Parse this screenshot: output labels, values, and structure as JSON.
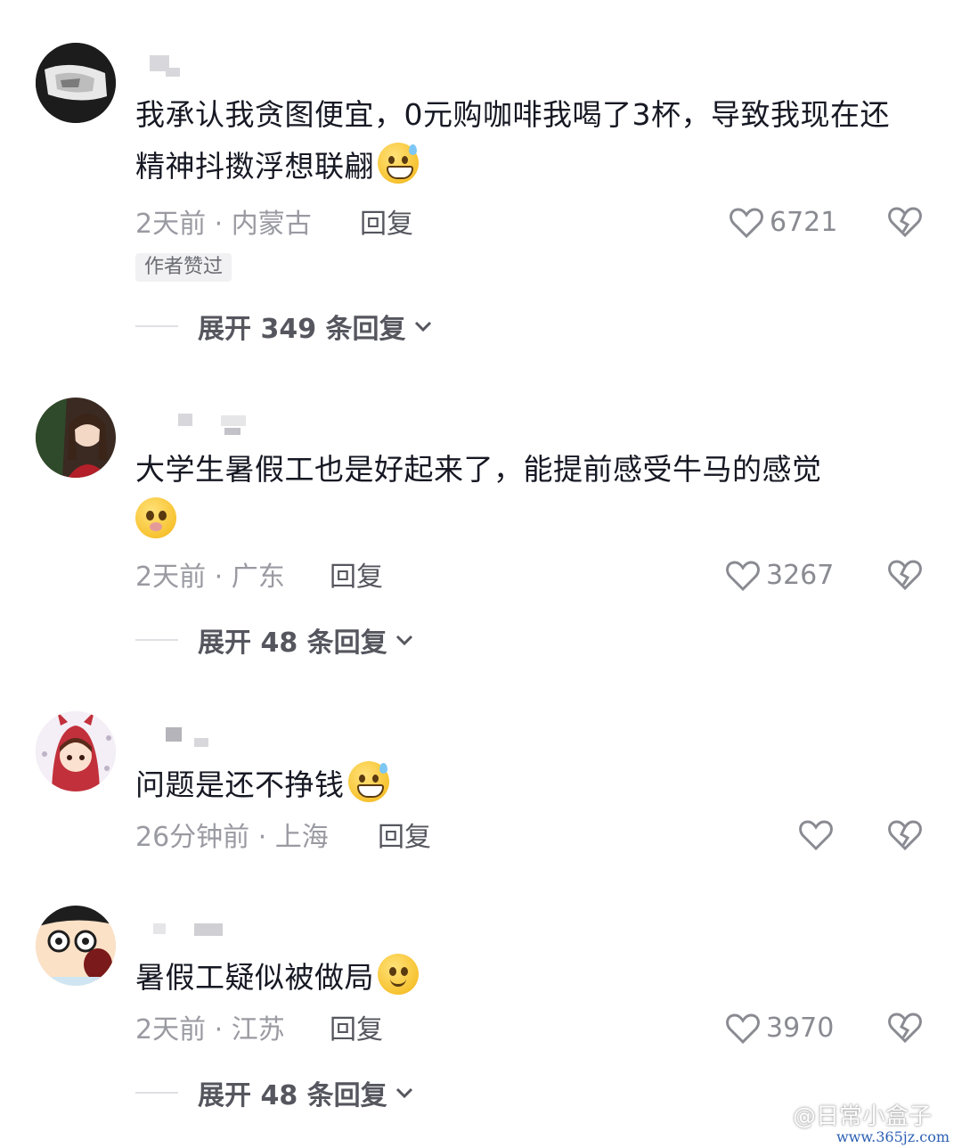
{
  "comments": [
    {
      "text": "我承认我贪图便宜，0元购咖啡我喝了3杯，导致我现在还精神抖擞浮想联翩",
      "meta": "2天前 · 内蒙古",
      "reply_label": "回复",
      "likes": "6721",
      "badge": "作者赞过",
      "expand": "展开 349 条回复",
      "emoji": "grin-sweat-emoji"
    },
    {
      "text": "大学生暑假工也是好起来了，能提前感受牛马的感觉",
      "meta": "2天前 · 广东",
      "reply_label": "回复",
      "likes": "3267",
      "expand": "展开 48 条回复",
      "emoji": "pleading-emoji"
    },
    {
      "text": "问题是还不挣钱",
      "meta": "26分钟前 · 上海",
      "reply_label": "回复",
      "likes": "",
      "emoji": "grin-sweat-emoji"
    },
    {
      "text": "暑假工疑似被做局",
      "meta": "2天前 · 江苏",
      "reply_label": "回复",
      "likes": "3970",
      "expand": "展开 48 条回复",
      "emoji": "smile-emoji"
    }
  ],
  "watermark": {
    "text": "@日常小盒子",
    "url": "www.365jz.com"
  },
  "colors": {
    "text": "#161823",
    "meta": "#9a9aa2",
    "icon": "#8a8b92"
  }
}
